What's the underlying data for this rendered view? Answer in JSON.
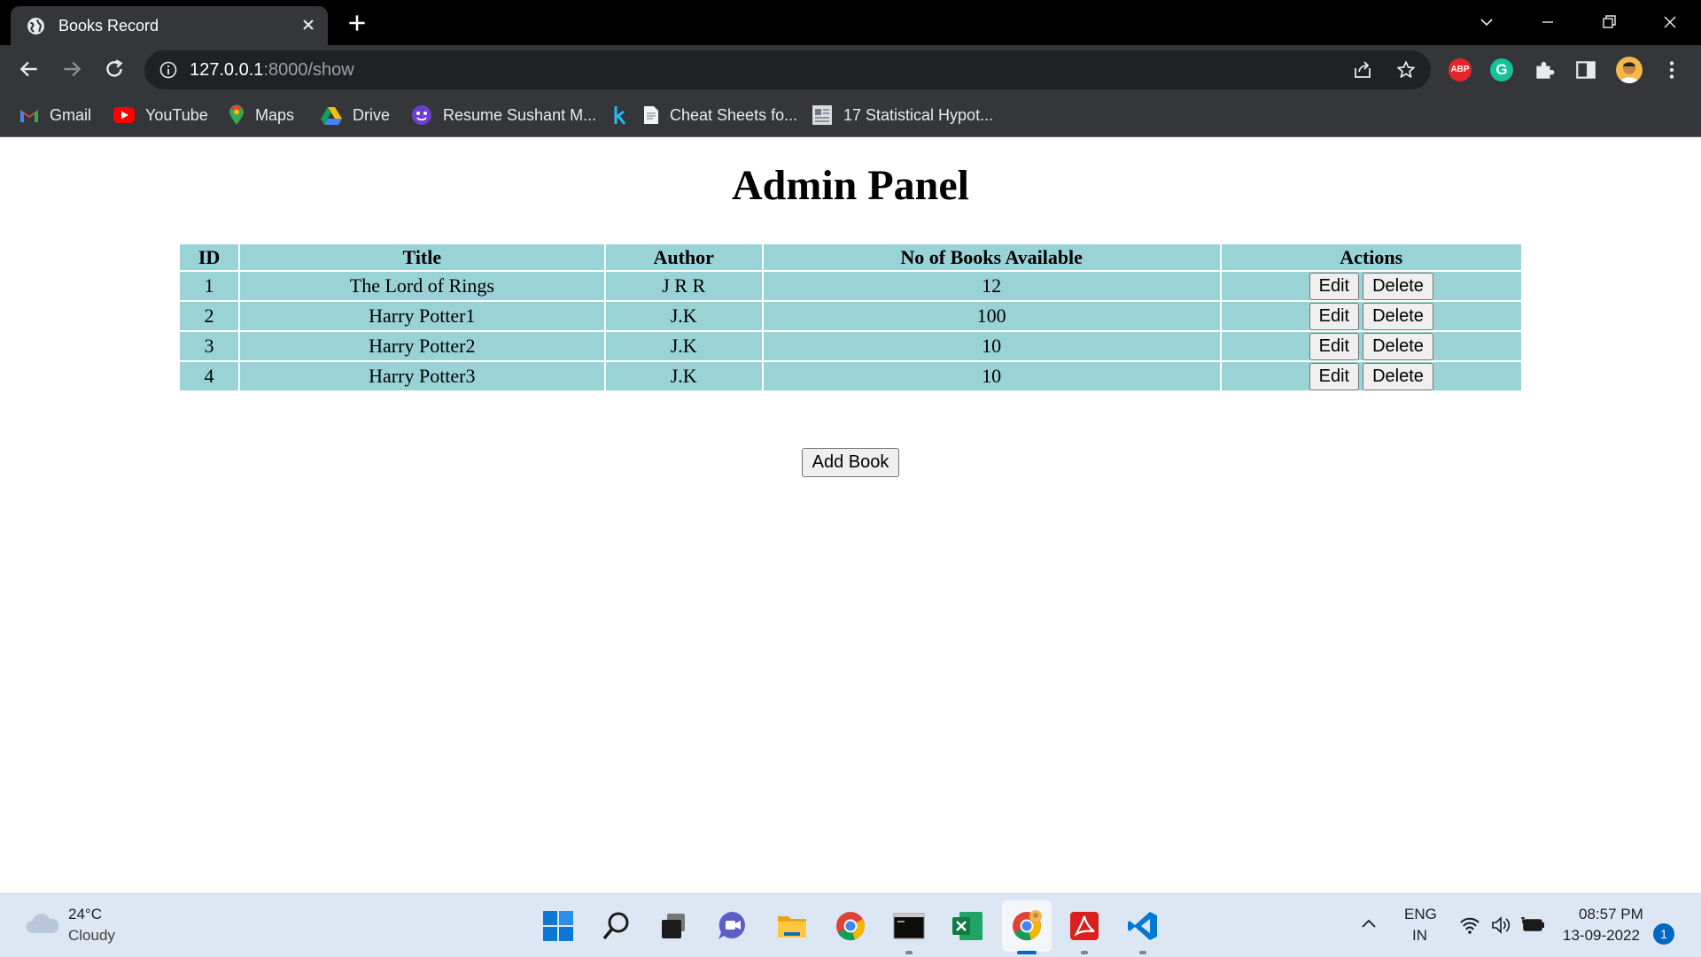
{
  "browser": {
    "tab_title": "Books Record",
    "url_host": "127.0.0.1",
    "url_path": ":8000/show",
    "bookmarks": [
      {
        "label": "Gmail",
        "icon": "gmail-icon"
      },
      {
        "label": "YouTube",
        "icon": "youtube-icon"
      },
      {
        "label": "Maps",
        "icon": "maps-icon"
      },
      {
        "label": "Drive",
        "icon": "drive-icon"
      },
      {
        "label": "Resume Sushant M...",
        "icon": "resume-icon"
      },
      {
        "label": "",
        "icon": "k-icon"
      },
      {
        "label": "Cheat Sheets fo...",
        "icon": "document-icon"
      },
      {
        "label": "17 Statistical Hypot...",
        "icon": "image-icon"
      }
    ],
    "extensions": {
      "abp_label": "ABP",
      "grammarly_label": "G"
    }
  },
  "page": {
    "title": "Admin Panel",
    "table": {
      "headers": [
        "ID",
        "Title",
        "Author",
        "No of Books Available",
        "Actions"
      ],
      "rows": [
        {
          "id": "1",
          "title": "The Lord of Rings",
          "author": "J R R",
          "count": "12"
        },
        {
          "id": "2",
          "title": "Harry Potter1",
          "author": "J.K",
          "count": "100"
        },
        {
          "id": "3",
          "title": "Harry Potter2",
          "author": "J.K",
          "count": "10"
        },
        {
          "id": "4",
          "title": "Harry Potter3",
          "author": "J.K",
          "count": "10"
        }
      ],
      "edit_label": "Edit",
      "delete_label": "Delete"
    },
    "add_button_label": "Add Book"
  },
  "taskbar": {
    "weather_temp": "24°C",
    "weather_desc": "Cloudy",
    "lang_top": "ENG",
    "lang_bottom": "IN",
    "time": "08:57 PM",
    "date": "13-09-2022",
    "notification_count": "1"
  },
  "colors": {
    "table_cell": "#99d3d6",
    "tab_strip": "#000000",
    "toolbar": "#35363a",
    "taskbar": "#dde7f3"
  }
}
